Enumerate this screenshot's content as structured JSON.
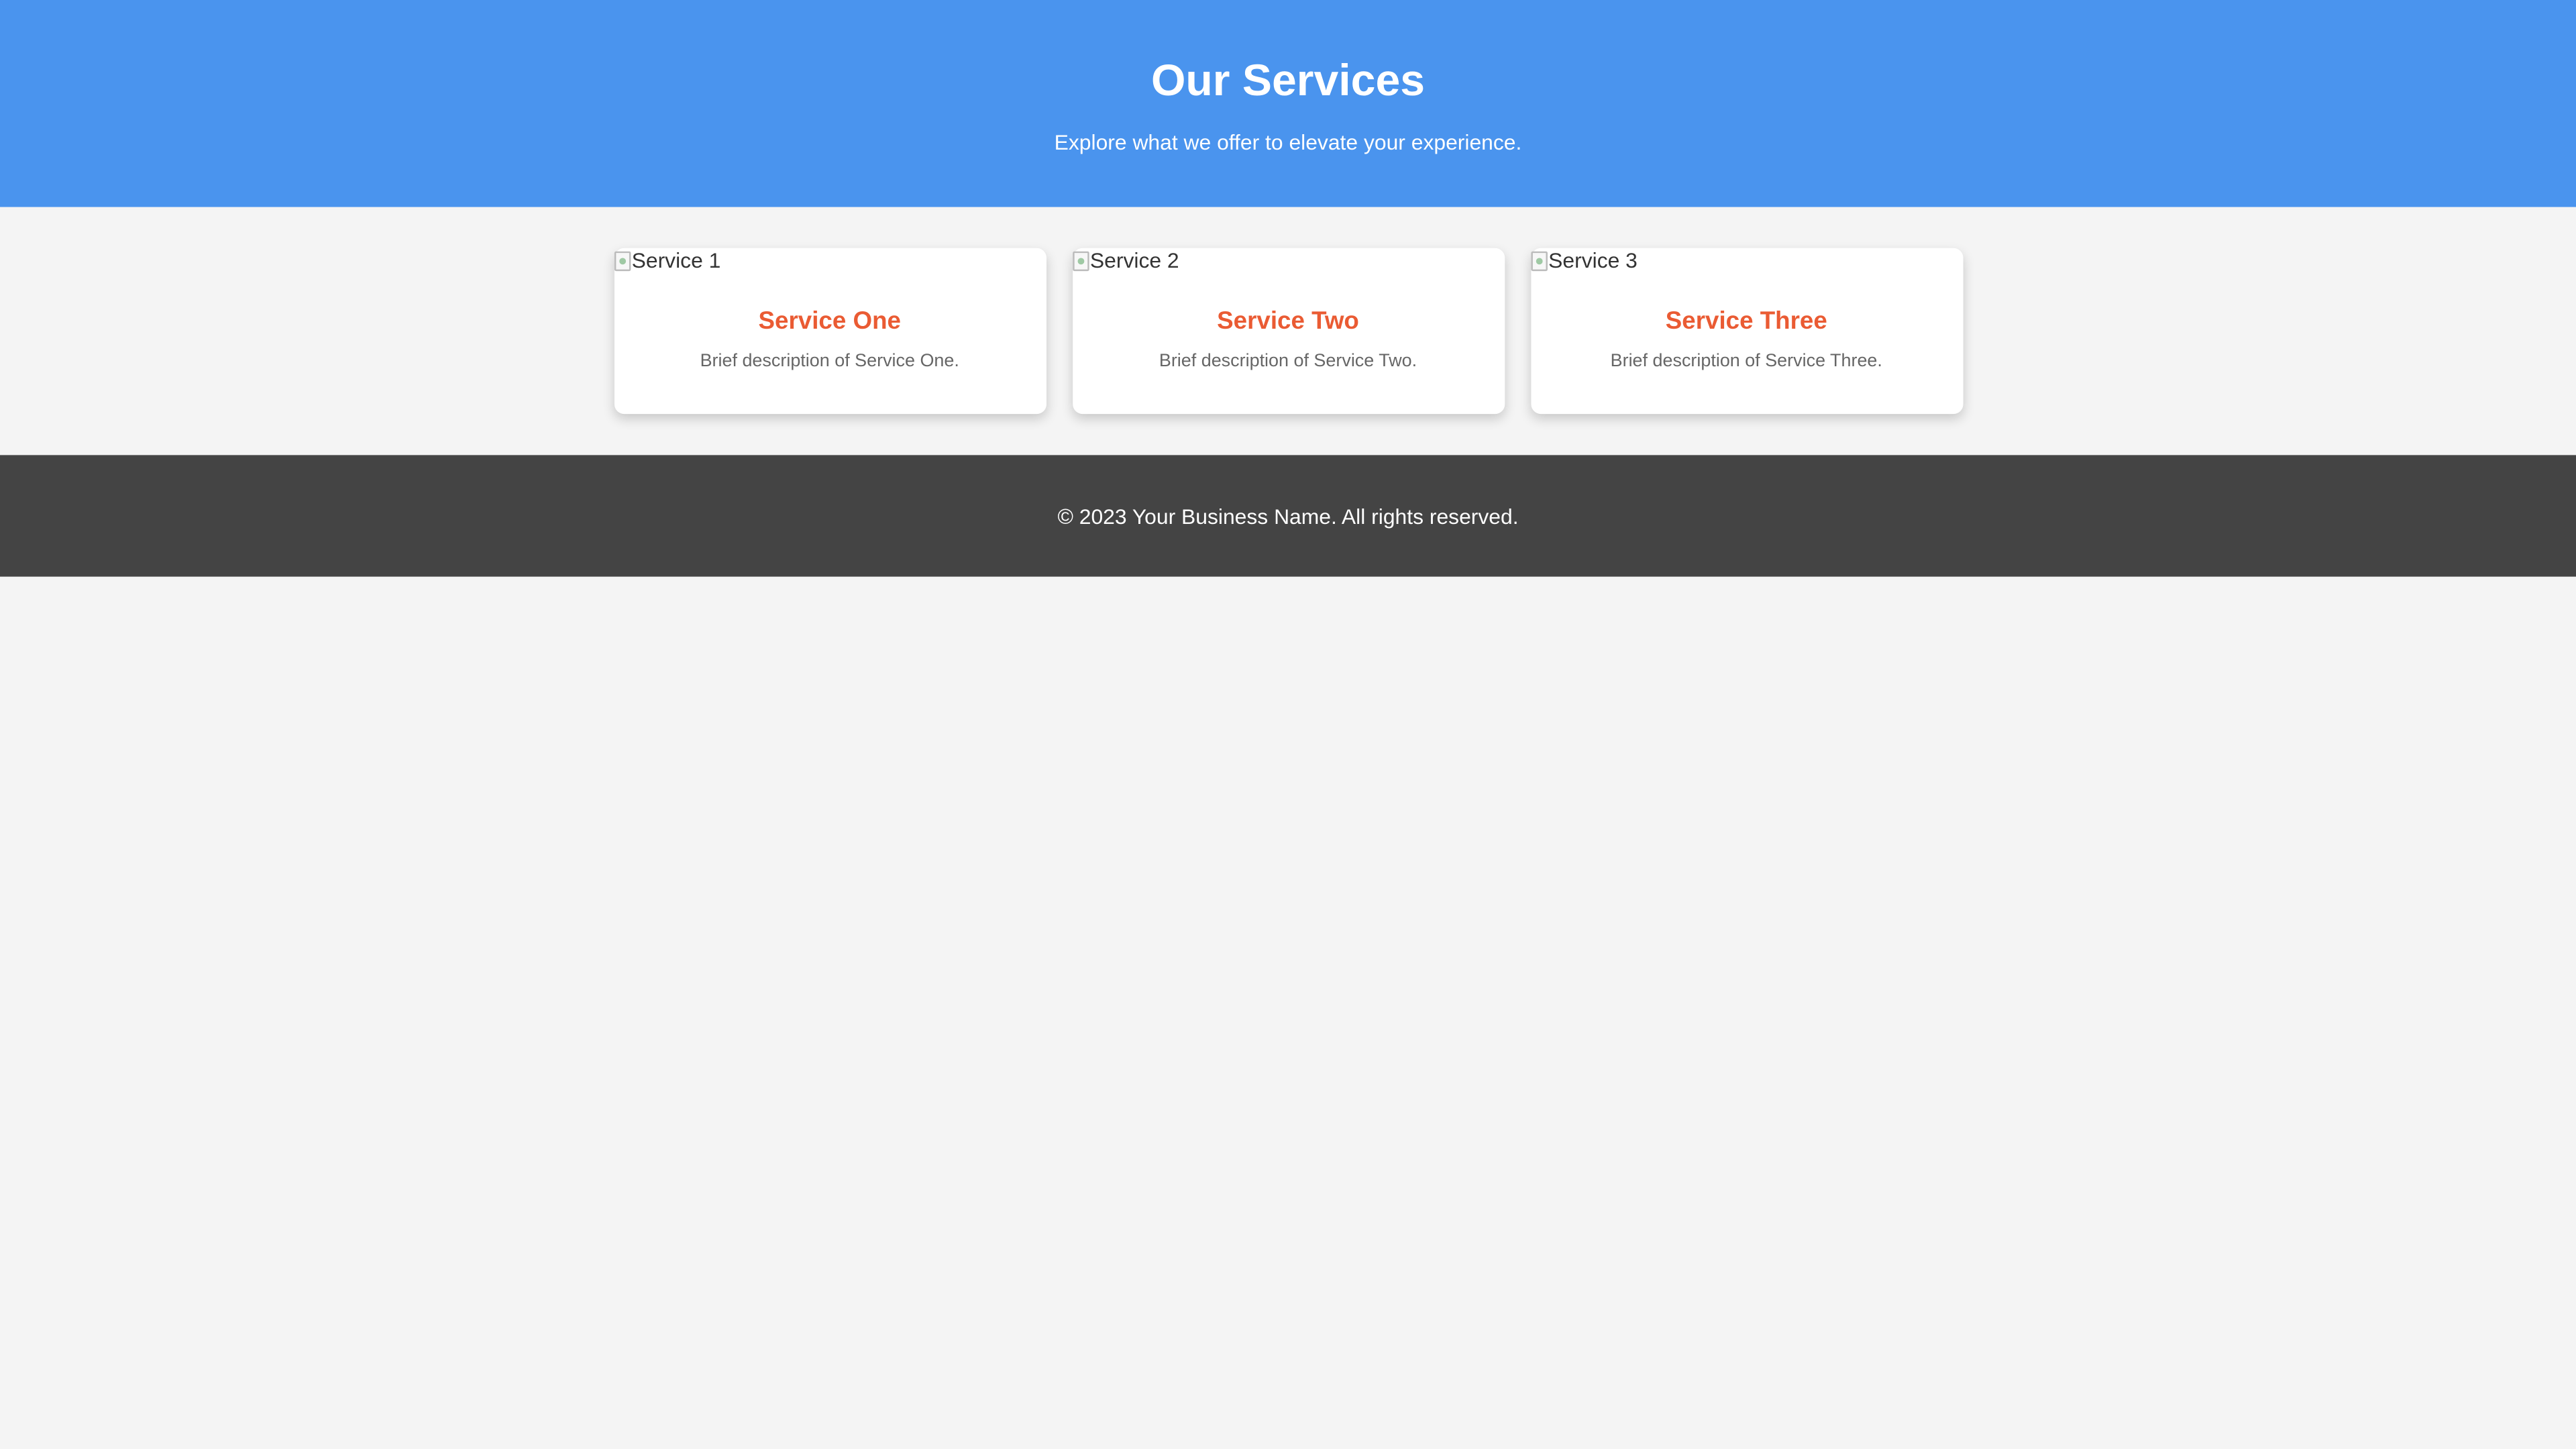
{
  "header": {
    "title": "Our Services",
    "subtitle": "Explore what we offer to elevate your experience."
  },
  "services": [
    {
      "image_alt": "Service 1",
      "title": "Service One",
      "description": "Brief description of Service One."
    },
    {
      "image_alt": "Service 2",
      "title": "Service Two",
      "description": "Brief description of Service Two."
    },
    {
      "image_alt": "Service 3",
      "title": "Service Three",
      "description": "Brief description of Service Three."
    }
  ],
  "footer": {
    "copyright": "© 2023 Your Business Name. All rights reserved."
  },
  "colors": {
    "header_bg": "#4a94ee",
    "accent": "#ea5b33",
    "footer_bg": "#444444",
    "page_bg": "#f4f4f4"
  }
}
